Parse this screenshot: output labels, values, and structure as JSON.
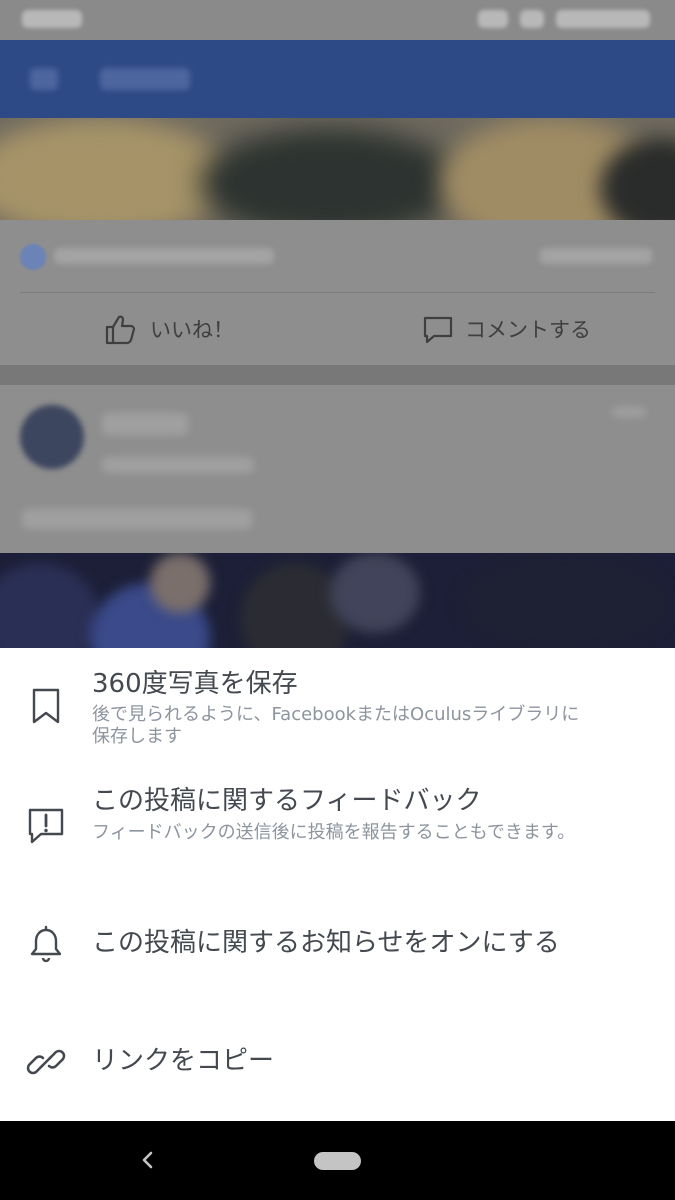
{
  "background_post": {
    "like_label": "いいね！",
    "comment_label": "コメントする"
  },
  "menu": {
    "items": [
      {
        "title": "360度写真を保存",
        "subtitle": "後で見られるように、FacebookまたはOculusライブラリに保存します",
        "icon": "bookmark-icon"
      },
      {
        "title": "この投稿に関するフィードバック",
        "subtitle": "フィードバックの送信後に投稿を報告することもできます。",
        "icon": "feedback-icon"
      },
      {
        "title": "この投稿に関するお知らせをオンにする",
        "icon": "bell-icon"
      },
      {
        "title": "リンクをコピー",
        "icon": "link-icon"
      }
    ]
  },
  "colors": {
    "sheet_background": "#ffffff",
    "menu_title": "#444950",
    "menu_subtitle": "#8d949e",
    "facebook_blue_dimmed": "#2e4a86",
    "nav_bar": "#000000"
  }
}
